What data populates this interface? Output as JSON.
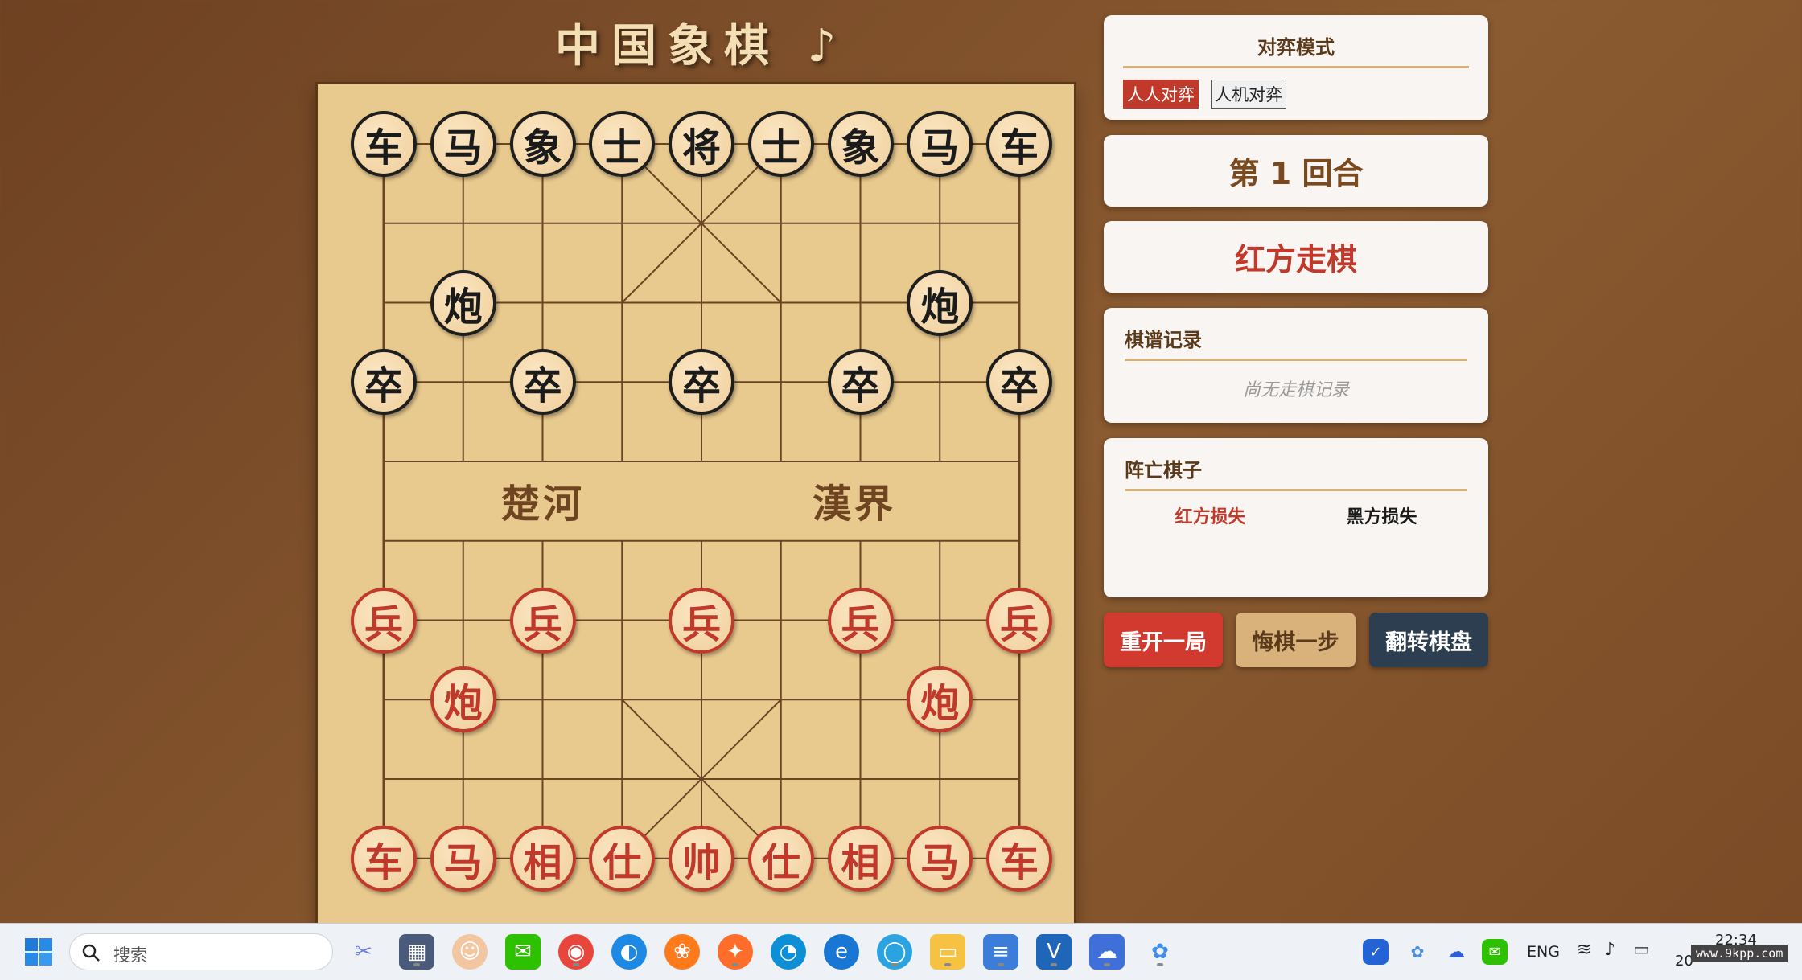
{
  "title": "中国象棋 ♪",
  "board": {
    "river_left": "楚河",
    "river_right": "漢界",
    "pieces": [
      {
        "label": "车",
        "side": "black",
        "col": 0,
        "row": 0
      },
      {
        "label": "马",
        "side": "black",
        "col": 1,
        "row": 0
      },
      {
        "label": "象",
        "side": "black",
        "col": 2,
        "row": 0
      },
      {
        "label": "士",
        "side": "black",
        "col": 3,
        "row": 0
      },
      {
        "label": "将",
        "side": "black",
        "col": 4,
        "row": 0
      },
      {
        "label": "士",
        "side": "black",
        "col": 5,
        "row": 0
      },
      {
        "label": "象",
        "side": "black",
        "col": 6,
        "row": 0
      },
      {
        "label": "马",
        "side": "black",
        "col": 7,
        "row": 0
      },
      {
        "label": "车",
        "side": "black",
        "col": 8,
        "row": 0
      },
      {
        "label": "炮",
        "side": "black",
        "col": 1,
        "row": 2
      },
      {
        "label": "炮",
        "side": "black",
        "col": 7,
        "row": 2
      },
      {
        "label": "卒",
        "side": "black",
        "col": 0,
        "row": 3
      },
      {
        "label": "卒",
        "side": "black",
        "col": 2,
        "row": 3
      },
      {
        "label": "卒",
        "side": "black",
        "col": 4,
        "row": 3
      },
      {
        "label": "卒",
        "side": "black",
        "col": 6,
        "row": 3
      },
      {
        "label": "卒",
        "side": "black",
        "col": 8,
        "row": 3
      },
      {
        "label": "兵",
        "side": "red",
        "col": 0,
        "row": 6
      },
      {
        "label": "兵",
        "side": "red",
        "col": 2,
        "row": 6
      },
      {
        "label": "兵",
        "side": "red",
        "col": 4,
        "row": 6
      },
      {
        "label": "兵",
        "side": "red",
        "col": 6,
        "row": 6
      },
      {
        "label": "兵",
        "side": "red",
        "col": 8,
        "row": 6
      },
      {
        "label": "炮",
        "side": "red",
        "col": 1,
        "row": 7
      },
      {
        "label": "炮",
        "side": "red",
        "col": 7,
        "row": 7
      },
      {
        "label": "车",
        "side": "red",
        "col": 0,
        "row": 9
      },
      {
        "label": "马",
        "side": "red",
        "col": 1,
        "row": 9
      },
      {
        "label": "相",
        "side": "red",
        "col": 2,
        "row": 9
      },
      {
        "label": "仕",
        "side": "red",
        "col": 3,
        "row": 9
      },
      {
        "label": "帅",
        "side": "red",
        "col": 4,
        "row": 9
      },
      {
        "label": "仕",
        "side": "red",
        "col": 5,
        "row": 9
      },
      {
        "label": "相",
        "side": "red",
        "col": 6,
        "row": 9
      },
      {
        "label": "马",
        "side": "red",
        "col": 7,
        "row": 9
      },
      {
        "label": "车",
        "side": "red",
        "col": 8,
        "row": 9
      }
    ]
  },
  "mode_panel": {
    "heading": "对弈模式",
    "options": [
      "人人对弈",
      "人机对弈"
    ],
    "selected": "人人对弈"
  },
  "round_text": "第 1 回合",
  "turn_text": "红方走棋",
  "record_panel": {
    "heading": "棋谱记录",
    "empty_text": "尚无走棋记录"
  },
  "captured_panel": {
    "heading": "阵亡棋子",
    "red_label": "红方损失",
    "black_label": "黑方损失"
  },
  "buttons": {
    "restart": "重开一局",
    "undo": "悔棋一步",
    "flip": "翻转棋盘"
  },
  "taskbar": {
    "search_placeholder": "搜索",
    "lang": "ENG",
    "time": "22:34",
    "date_partial": "20",
    "watermark": "www.9kpp.com"
  },
  "colors": {
    "red_piece": "#c0392b",
    "black_piece": "#1b1b1b",
    "board": "#e8c98e",
    "restart_btn": "#d23a30",
    "undo_btn": "#d8b27a",
    "flip_btn": "#2c3e50"
  }
}
